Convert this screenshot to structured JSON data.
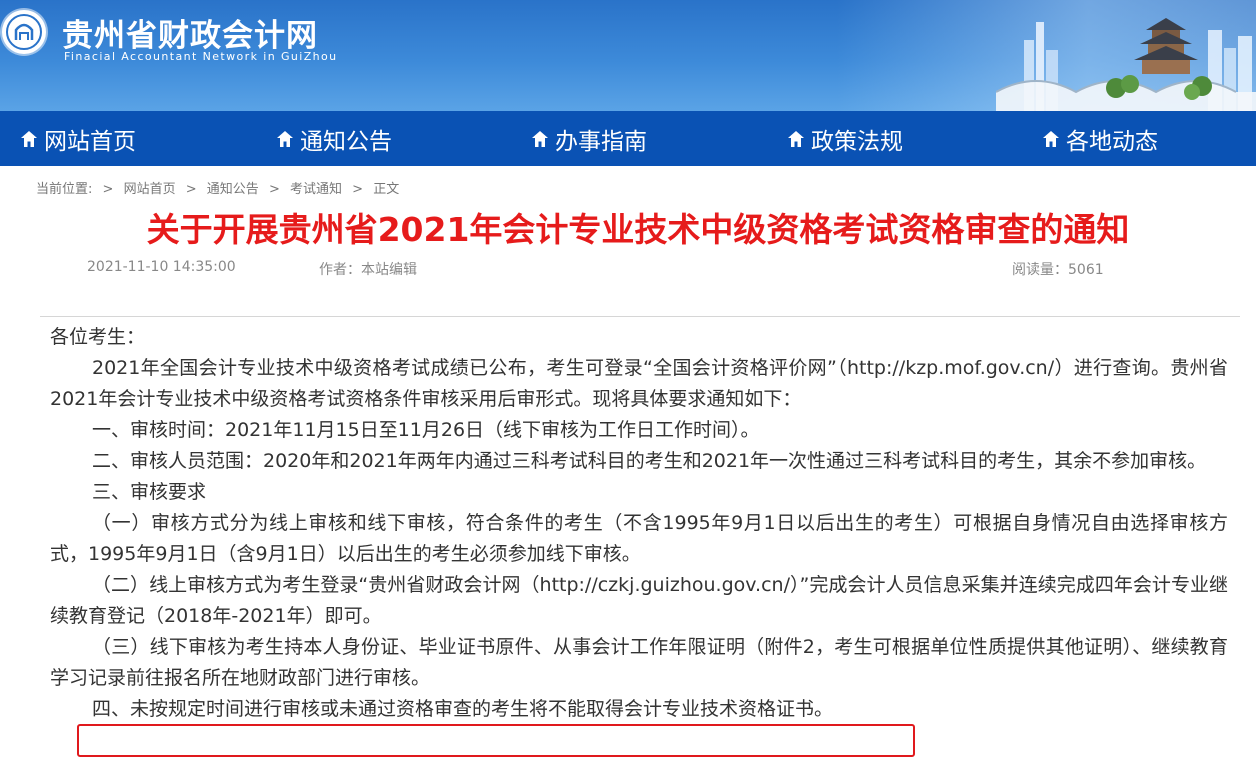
{
  "header": {
    "site_title": "贵州省财政会计网",
    "site_subtitle": "Finacial  Accountant Network in GuiZhou"
  },
  "nav": [
    {
      "label": "网站首页",
      "icon": "home-icon"
    },
    {
      "label": "通知公告",
      "icon": "home-icon"
    },
    {
      "label": "办事指南",
      "icon": "home-icon"
    },
    {
      "label": "政策法规",
      "icon": "home-icon"
    },
    {
      "label": "各地动态",
      "icon": "home-icon"
    }
  ],
  "breadcrumb": {
    "prefix": "当前位置:",
    "items": [
      "网站首页",
      "通知公告",
      "考试通知",
      "正文"
    ],
    "separator": ">"
  },
  "article": {
    "title": "关于开展贵州省2021年会计专业技术中级资格考试资格审查的通知",
    "datetime": "2021-11-10 14:35:00",
    "author": "作者：本站编辑",
    "views": "阅读量：5061",
    "paragraphs": [
      "各位考生：",
      "2021年全国会计专业技术中级资格考试成绩已公布，考生可登录“全国会计资格评价网”（http://kzp.mof.gov.cn/）进行查询。贵州省2021年会计专业技术中级资格考试资格条件审核采用后审形式。现将具体要求通知如下：",
      "一、审核时间：2021年11月15日至11月26日（线下审核为工作日工作时间）。",
      "二、审核人员范围：2020年和2021年两年内通过三科考试科目的考生和2021年一次性通过三科考试科目的考生，其余不参加审核。",
      "三、审核要求",
      "（一）审核方式分为线上审核和线下审核，符合条件的考生（不含1995年9月1日以后出生的考生）可根据自身情况自由选择审核方式，1995年9月1日（含9月1日）以后出生的考生必须参加线下审核。",
      "（二）线上审核方式为考生登录“贵州省财政会计网（http://czkj.guizhou.gov.cn/）”完成会计人员信息采集并连续完成四年会计专业继续教育登记（2018年-2021年）即可。",
      "（三）线下审核为考生持本人身份证、毕业证书原件、从事会计工作年限证明（附件2，考生可根据单位性质提供其他证明）、继续教育学习记录前往报名所在地财政部门进行审核。",
      "四、未按规定时间进行审核或未通过资格审查的考生将不能取得会计专业技术资格证书。"
    ]
  },
  "colors": {
    "nav_bg": "#0a52b4",
    "title_red": "#e61b1b",
    "highlight_border": "#e0191d"
  }
}
